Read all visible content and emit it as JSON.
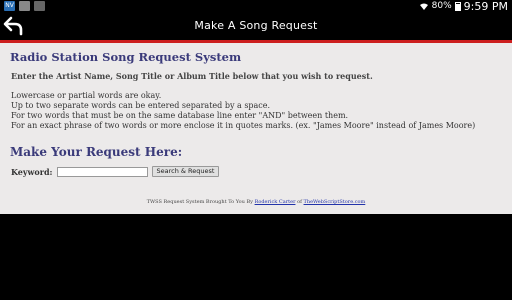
{
  "status_bar": {
    "battery": "80%",
    "time": "9:59 PM",
    "notification_icons": [
      "nv-app-icon",
      "image-icon",
      "video-icon"
    ]
  },
  "action_bar": {
    "title": "Make A Song Request"
  },
  "page": {
    "title": "Radio Station Song Request System",
    "intro": "Enter the Artist Name, Song Title or Album Title below that you wish to request.",
    "rules": [
      "Lowercase or partial words are okay.",
      "Up to two separate words can be entered separated by a space.",
      "For two words that must be on the same database line enter \"AND\" between them.",
      "For an exact phrase of two words or more enclose it in quotes marks. (ex. \"James Moore\" instead of James Moore)"
    ],
    "section_title": "Make Your Request Here:",
    "keyword_label": "Keyword:",
    "keyword_value": "",
    "search_button": "Search & Request",
    "footer": {
      "prefix": "TWSS Request System Brought To You By",
      "author_link": "Roderick Carter",
      "middle": "of",
      "site_link": "TheWebScriptStore.com"
    }
  },
  "colors": {
    "accent": "#cc1e1e",
    "heading": "#3a3a7a",
    "background": "#eceaea",
    "link": "#2233aa"
  }
}
